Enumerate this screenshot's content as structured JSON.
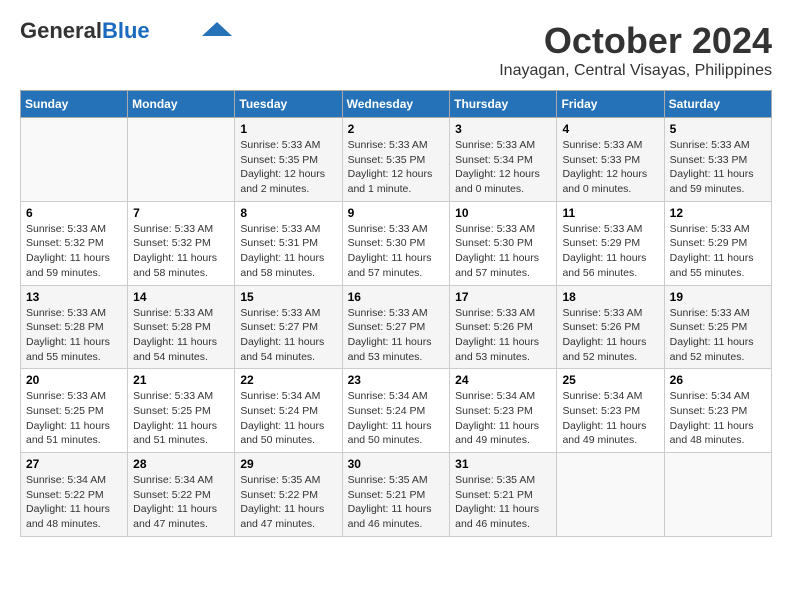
{
  "header": {
    "logo_general": "General",
    "logo_blue": "Blue",
    "month_title": "October 2024",
    "location": "Inayagan, Central Visayas, Philippines"
  },
  "weekdays": [
    "Sunday",
    "Monday",
    "Tuesday",
    "Wednesday",
    "Thursday",
    "Friday",
    "Saturday"
  ],
  "weeks": [
    [
      {
        "day": "",
        "info": ""
      },
      {
        "day": "",
        "info": ""
      },
      {
        "day": "1",
        "info": "Sunrise: 5:33 AM\nSunset: 5:35 PM\nDaylight: 12 hours\nand 2 minutes."
      },
      {
        "day": "2",
        "info": "Sunrise: 5:33 AM\nSunset: 5:35 PM\nDaylight: 12 hours\nand 1 minute."
      },
      {
        "day": "3",
        "info": "Sunrise: 5:33 AM\nSunset: 5:34 PM\nDaylight: 12 hours\nand 0 minutes."
      },
      {
        "day": "4",
        "info": "Sunrise: 5:33 AM\nSunset: 5:33 PM\nDaylight: 12 hours\nand 0 minutes."
      },
      {
        "day": "5",
        "info": "Sunrise: 5:33 AM\nSunset: 5:33 PM\nDaylight: 11 hours\nand 59 minutes."
      }
    ],
    [
      {
        "day": "6",
        "info": "Sunrise: 5:33 AM\nSunset: 5:32 PM\nDaylight: 11 hours\nand 59 minutes."
      },
      {
        "day": "7",
        "info": "Sunrise: 5:33 AM\nSunset: 5:32 PM\nDaylight: 11 hours\nand 58 minutes."
      },
      {
        "day": "8",
        "info": "Sunrise: 5:33 AM\nSunset: 5:31 PM\nDaylight: 11 hours\nand 58 minutes."
      },
      {
        "day": "9",
        "info": "Sunrise: 5:33 AM\nSunset: 5:30 PM\nDaylight: 11 hours\nand 57 minutes."
      },
      {
        "day": "10",
        "info": "Sunrise: 5:33 AM\nSunset: 5:30 PM\nDaylight: 11 hours\nand 57 minutes."
      },
      {
        "day": "11",
        "info": "Sunrise: 5:33 AM\nSunset: 5:29 PM\nDaylight: 11 hours\nand 56 minutes."
      },
      {
        "day": "12",
        "info": "Sunrise: 5:33 AM\nSunset: 5:29 PM\nDaylight: 11 hours\nand 55 minutes."
      }
    ],
    [
      {
        "day": "13",
        "info": "Sunrise: 5:33 AM\nSunset: 5:28 PM\nDaylight: 11 hours\nand 55 minutes."
      },
      {
        "day": "14",
        "info": "Sunrise: 5:33 AM\nSunset: 5:28 PM\nDaylight: 11 hours\nand 54 minutes."
      },
      {
        "day": "15",
        "info": "Sunrise: 5:33 AM\nSunset: 5:27 PM\nDaylight: 11 hours\nand 54 minutes."
      },
      {
        "day": "16",
        "info": "Sunrise: 5:33 AM\nSunset: 5:27 PM\nDaylight: 11 hours\nand 53 minutes."
      },
      {
        "day": "17",
        "info": "Sunrise: 5:33 AM\nSunset: 5:26 PM\nDaylight: 11 hours\nand 53 minutes."
      },
      {
        "day": "18",
        "info": "Sunrise: 5:33 AM\nSunset: 5:26 PM\nDaylight: 11 hours\nand 52 minutes."
      },
      {
        "day": "19",
        "info": "Sunrise: 5:33 AM\nSunset: 5:25 PM\nDaylight: 11 hours\nand 52 minutes."
      }
    ],
    [
      {
        "day": "20",
        "info": "Sunrise: 5:33 AM\nSunset: 5:25 PM\nDaylight: 11 hours\nand 51 minutes."
      },
      {
        "day": "21",
        "info": "Sunrise: 5:33 AM\nSunset: 5:25 PM\nDaylight: 11 hours\nand 51 minutes."
      },
      {
        "day": "22",
        "info": "Sunrise: 5:34 AM\nSunset: 5:24 PM\nDaylight: 11 hours\nand 50 minutes."
      },
      {
        "day": "23",
        "info": "Sunrise: 5:34 AM\nSunset: 5:24 PM\nDaylight: 11 hours\nand 50 minutes."
      },
      {
        "day": "24",
        "info": "Sunrise: 5:34 AM\nSunset: 5:23 PM\nDaylight: 11 hours\nand 49 minutes."
      },
      {
        "day": "25",
        "info": "Sunrise: 5:34 AM\nSunset: 5:23 PM\nDaylight: 11 hours\nand 49 minutes."
      },
      {
        "day": "26",
        "info": "Sunrise: 5:34 AM\nSunset: 5:23 PM\nDaylight: 11 hours\nand 48 minutes."
      }
    ],
    [
      {
        "day": "27",
        "info": "Sunrise: 5:34 AM\nSunset: 5:22 PM\nDaylight: 11 hours\nand 48 minutes."
      },
      {
        "day": "28",
        "info": "Sunrise: 5:34 AM\nSunset: 5:22 PM\nDaylight: 11 hours\nand 47 minutes."
      },
      {
        "day": "29",
        "info": "Sunrise: 5:35 AM\nSunset: 5:22 PM\nDaylight: 11 hours\nand 47 minutes."
      },
      {
        "day": "30",
        "info": "Sunrise: 5:35 AM\nSunset: 5:21 PM\nDaylight: 11 hours\nand 46 minutes."
      },
      {
        "day": "31",
        "info": "Sunrise: 5:35 AM\nSunset: 5:21 PM\nDaylight: 11 hours\nand 46 minutes."
      },
      {
        "day": "",
        "info": ""
      },
      {
        "day": "",
        "info": ""
      }
    ]
  ]
}
